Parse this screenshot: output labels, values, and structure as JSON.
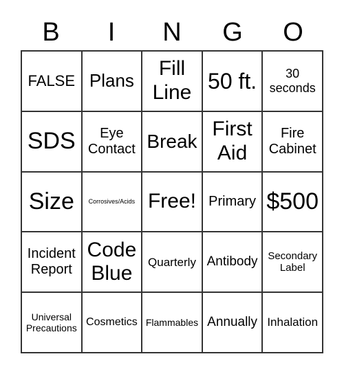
{
  "header": [
    "B",
    "I",
    "N",
    "G",
    "O"
  ],
  "cells": [
    [
      "FALSE",
      "Plans",
      "Fill Line",
      "50 ft.",
      "30 seconds"
    ],
    [
      "SDS",
      "Eye Contact",
      "Break",
      "First Aid",
      "Fire Cabinet"
    ],
    [
      "Size",
      "Corrosives/Acids",
      "Free!",
      "Primary",
      "$500"
    ],
    [
      "Incident Report",
      "Code Blue",
      "Quarterly",
      "Antibody",
      "Secondary Label"
    ],
    [
      "Universal Precautions",
      "Cosmetics",
      "Flammables",
      "Annually",
      "Inhalation"
    ]
  ]
}
